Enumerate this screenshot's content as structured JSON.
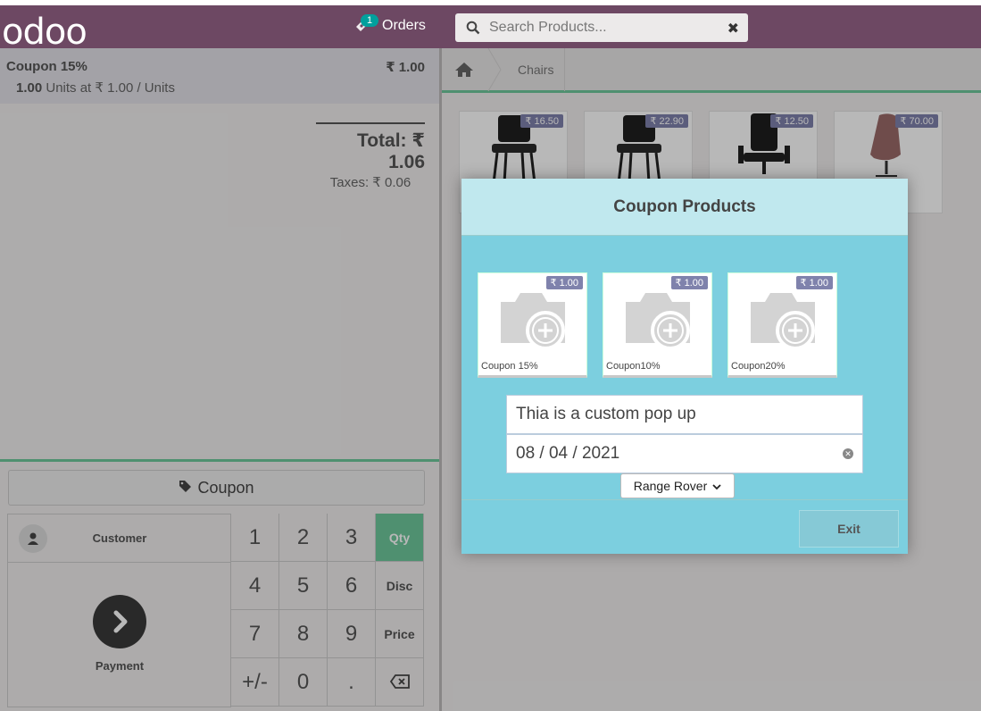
{
  "header": {
    "logo_text": "odoo",
    "orders_label": "Orders",
    "orders_count": "1",
    "search_placeholder": "Search Products..."
  },
  "order": {
    "line": {
      "name": "Coupon 15%",
      "price": "₹ 1.00",
      "quantity": "1.00",
      "unit_text": "Units at ₹ 1.00 / Units"
    },
    "total_label": "Total: ₹ 1.06",
    "taxes_label": "Taxes: ₹ 0.06"
  },
  "controls": {
    "coupon_button": "Coupon",
    "customer_button": "Customer",
    "payment_button": "Payment",
    "numpad": {
      "keys": [
        "1",
        "2",
        "3",
        "4",
        "5",
        "6",
        "7",
        "8",
        "9",
        "+/-",
        "0",
        "."
      ],
      "modes": [
        "Qty",
        "Disc",
        "Price"
      ],
      "active_mode": "Qty"
    }
  },
  "categories": {
    "breadcrumb": [
      "Chairs"
    ]
  },
  "products": [
    {
      "price": "₹ 16.50"
    },
    {
      "price": "₹ 22.90"
    },
    {
      "price": "₹ 12.50"
    },
    {
      "price": "₹ 70.00"
    }
  ],
  "modal": {
    "title": "Coupon Products",
    "coupons": [
      {
        "name": "Coupon 15%",
        "price": "₹ 1.00"
      },
      {
        "name": "Coupon10%",
        "price": "₹ 1.00"
      },
      {
        "name": "Coupon20%",
        "price": "₹ 1.00"
      }
    ],
    "text_value": "Thia is a custom pop up",
    "date_value": "08 / 04 / 2021",
    "select_value": "Range Rover",
    "exit_button": "Exit"
  },
  "colors": {
    "header_bg": "#6d4863",
    "accent_green": "#6ec89b",
    "modal_bg": "#7ccfdf",
    "price_tag": "#7f82ac"
  }
}
